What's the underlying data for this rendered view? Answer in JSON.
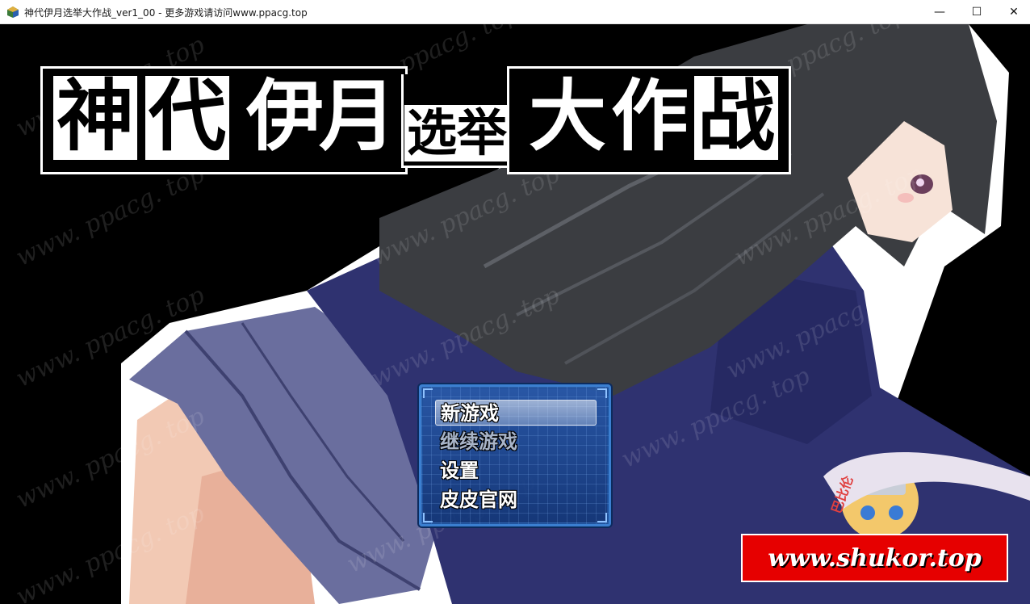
{
  "window": {
    "title": "神代伊月选举大作战_ver1_00 - 更多游戏请访问www.ppacg.top",
    "controls": {
      "minimize": "—",
      "maximize": "☐",
      "close": "✕"
    }
  },
  "logo": {
    "chars": [
      "神",
      "代",
      "伊",
      "月",
      "选",
      "举",
      "大",
      "作",
      "战"
    ]
  },
  "menu": {
    "items": [
      {
        "label": "新游戏",
        "state": "selected"
      },
      {
        "label": "继续游戏",
        "state": "disabled"
      },
      {
        "label": "设置",
        "state": "normal"
      },
      {
        "label": "皮皮官网",
        "state": "normal"
      }
    ]
  },
  "watermark": {
    "text": "www. ppacg. top"
  },
  "mascot": {
    "banner_text": "巴比伦"
  },
  "banner": {
    "text": "www.shukor.top"
  },
  "colors": {
    "background": "#000000",
    "menu_frame": "#3b7fd0",
    "menu_fill": "#1d4f9a",
    "banner": "#e60000",
    "hair": "#3b3d41",
    "uniform": "#2f3270",
    "skirt": "#6a6e9e"
  }
}
